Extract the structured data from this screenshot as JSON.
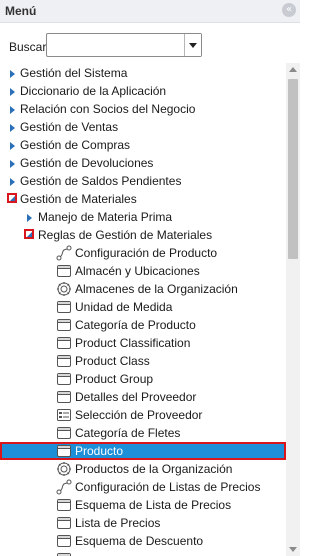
{
  "panel": {
    "title": "Menú",
    "collapse_icon": "double-chevron-left-icon"
  },
  "search": {
    "label": "Buscar:",
    "value": ""
  },
  "colors": {
    "selected_bg": "#1d8ed8",
    "highlight_border": "#d9161c",
    "arrow": "#2a6fb8"
  },
  "tree": {
    "items": [
      {
        "label": "Gestión del Sistema",
        "level": 0,
        "type": "folder",
        "expanded": false
      },
      {
        "label": "Diccionario de la Aplicación",
        "level": 0,
        "type": "folder",
        "expanded": false
      },
      {
        "label": "Relación con Socios del Negocio",
        "level": 0,
        "type": "folder",
        "expanded": false
      },
      {
        "label": "Gestión de Ventas",
        "level": 0,
        "type": "folder",
        "expanded": false
      },
      {
        "label": "Gestión de Compras",
        "level": 0,
        "type": "folder",
        "expanded": false
      },
      {
        "label": "Gestión de Devoluciones",
        "level": 0,
        "type": "folder",
        "expanded": false
      },
      {
        "label": "Gestión de Saldos Pendientes",
        "level": 0,
        "type": "folder",
        "expanded": false
      },
      {
        "label": "Gestión de Materiales",
        "level": 0,
        "type": "folder",
        "expanded": true
      },
      {
        "label": "Manejo de Materia Prima",
        "level": 1,
        "type": "folder",
        "expanded": false
      },
      {
        "label": "Reglas de Gestión de Materiales",
        "level": 1,
        "type": "folder",
        "expanded": true
      },
      {
        "label": "Configuración de Producto",
        "level": 2,
        "type": "leaf",
        "icon": "workflow-icon"
      },
      {
        "label": "Almacén y Ubicaciones",
        "level": 2,
        "type": "leaf",
        "icon": "window-icon"
      },
      {
        "label": "Almacenes de la Organización",
        "level": 2,
        "type": "leaf",
        "icon": "process-icon"
      },
      {
        "label": "Unidad de Medida",
        "level": 2,
        "type": "leaf",
        "icon": "window-icon"
      },
      {
        "label": "Categoría de Producto",
        "level": 2,
        "type": "leaf",
        "icon": "window-icon"
      },
      {
        "label": "Product Classification",
        "level": 2,
        "type": "leaf",
        "icon": "window-icon"
      },
      {
        "label": "Product Class",
        "level": 2,
        "type": "leaf",
        "icon": "window-icon"
      },
      {
        "label": "Product Group",
        "level": 2,
        "type": "leaf",
        "icon": "window-icon"
      },
      {
        "label": "Detalles del Proveedor",
        "level": 2,
        "type": "leaf",
        "icon": "window-icon"
      },
      {
        "label": "Selección de Proveedor",
        "level": 2,
        "type": "leaf",
        "icon": "form-icon"
      },
      {
        "label": "Categoría de Fletes",
        "level": 2,
        "type": "leaf",
        "icon": "window-icon"
      },
      {
        "label": "Producto",
        "level": 2,
        "type": "leaf",
        "icon": "window-icon",
        "selected": true
      },
      {
        "label": "Productos de la Organización",
        "level": 2,
        "type": "leaf",
        "icon": "process-icon"
      },
      {
        "label": "Configuración de Listas de Precios",
        "level": 2,
        "type": "leaf",
        "icon": "workflow-icon"
      },
      {
        "label": "Esquema de Lista de Precios",
        "level": 2,
        "type": "leaf",
        "icon": "window-icon"
      },
      {
        "label": "Lista de Precios",
        "level": 2,
        "type": "leaf",
        "icon": "window-icon"
      },
      {
        "label": "Esquema de Descuento",
        "level": 2,
        "type": "leaf",
        "icon": "window-icon"
      },
      {
        "label": "",
        "level": 2,
        "type": "leaf",
        "icon": "window-icon"
      }
    ]
  }
}
